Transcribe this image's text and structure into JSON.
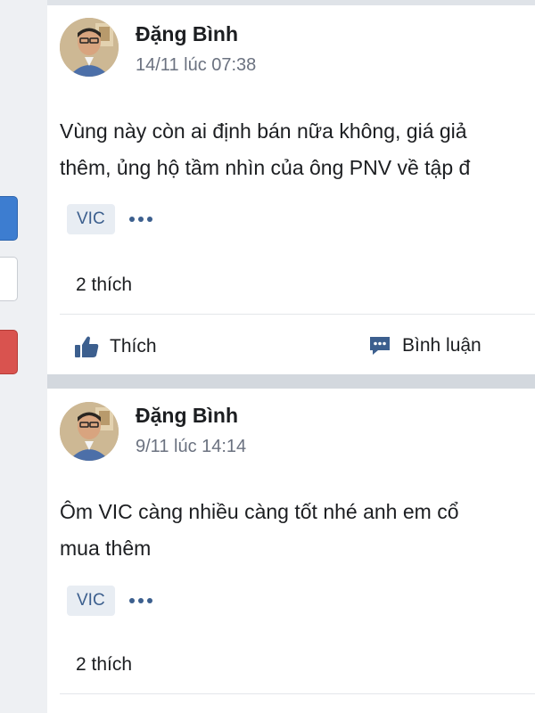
{
  "colors": {
    "accent": "#3c5f8e",
    "tag_bg": "#e8edf3",
    "page_bg": "#dfe3e8"
  },
  "posts": [
    {
      "author": "Đặng Bình",
      "time": "14/11 lúc 07:38",
      "content_lines": [
        "Vùng này còn ai định bán nữa không, giá giả",
        "thêm, ủng hộ tầm nhìn của ông PNV về tập đ"
      ],
      "tag": "VIC",
      "likes": "2 thích",
      "actions": {
        "like": "Thích",
        "comment": "Bình luận"
      }
    },
    {
      "author": "Đặng Bình",
      "time": "9/11 lúc 14:14",
      "content_lines": [
        "Ôm VIC càng nhiều càng tốt nhé anh em cổ",
        "mua thêm"
      ],
      "tag": "VIC",
      "likes": "2 thích"
    }
  ],
  "icons": {
    "like": "thumbs-up-icon",
    "comment": "comment-icon",
    "more": "more-options-icon"
  }
}
